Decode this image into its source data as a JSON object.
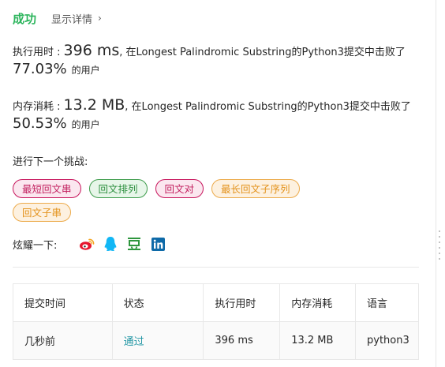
{
  "header": {
    "status": "成功",
    "details_link": "显示详情",
    "chevron": "›"
  },
  "runtime": {
    "label": "执行用时 :",
    "value": "396 ms",
    "description": ", 在Longest Palindromic Substring的Python3提交中击败了",
    "percent": "77.03%",
    "suffix": "的用户"
  },
  "memory": {
    "label": "内存消耗 :",
    "value": "13.2 MB",
    "description": ", 在Longest Palindromic Substring的Python3提交中击败了",
    "percent": "50.53%",
    "suffix": "的用户"
  },
  "next_challenge": {
    "label": "进行下一个挑战:",
    "tags": [
      {
        "label": "最短回文串",
        "difficulty": "hard"
      },
      {
        "label": "回文排列",
        "difficulty": "easy"
      },
      {
        "label": "回文对",
        "difficulty": "hard"
      },
      {
        "label": "最长回文子序列",
        "difficulty": "medium"
      },
      {
        "label": "回文子串",
        "difficulty": "medium"
      }
    ]
  },
  "share": {
    "label": "炫耀一下:",
    "icons": [
      "weibo-icon",
      "qq-icon",
      "douban-icon",
      "linkedin-icon"
    ]
  },
  "table": {
    "headers": [
      "提交时间",
      "状态",
      "执行用时",
      "内存消耗",
      "语言"
    ],
    "row": {
      "time": "几秒前",
      "status": "通过",
      "runtime": "396 ms",
      "memory": "13.2 MB",
      "language": "python3"
    }
  },
  "colors": {
    "success": "#2db55d",
    "hard": "#c7155c",
    "medium": "#ecaa4a",
    "easy": "#3e9c4c",
    "link": "#2196a4"
  }
}
